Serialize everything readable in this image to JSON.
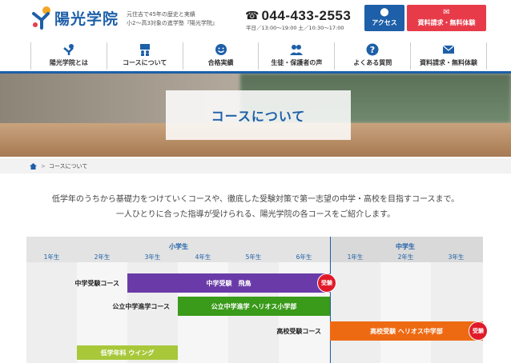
{
  "header": {
    "logo_text": "陽光学院",
    "tagline_line1": "元住吉で45年の歴史と実績",
    "tagline_line2": "小2〜高3対象の進学塾『陽光学院』",
    "phone_icon": "telephone-icon",
    "phone": "044-433-2553",
    "hours": "平日／13:00〜19:00  土／10:30〜17:00",
    "access_label": "アクセス",
    "request_label": "資料請求・無料体験"
  },
  "nav": {
    "items": [
      {
        "label": "陽光学院とは",
        "icon": "school-logo-icon"
      },
      {
        "label": "コースについて",
        "icon": "classroom-icon"
      },
      {
        "label": "合格実績",
        "icon": "smile-icon"
      },
      {
        "label": "生徒・保護者の声",
        "icon": "people-icon"
      },
      {
        "label": "よくある質問",
        "icon": "question-icon"
      },
      {
        "label": "資料請求・無料体験",
        "icon": "mail-icon"
      }
    ]
  },
  "hero": {
    "title": "コースについて"
  },
  "breadcrumb": {
    "home_icon": "home-icon",
    "separator": ">",
    "current": "コースについて"
  },
  "intro": {
    "line1": "低学年のうちから基礎力をつけていくコースや、徹底した受験対策で第一志望の中学・高校を目指すコースまで。",
    "line2": "一人ひとりに合った指導が受けられる、陽光学院の各コースをご紹介します。"
  },
  "course_table": {
    "elementary_label": "小学生",
    "junior_label": "中学生",
    "grades": [
      "1年生",
      "2年生",
      "3年生",
      "4年生",
      "5年生",
      "6年生",
      "1年生",
      "2年生",
      "3年生"
    ],
    "rows": [
      {
        "label": "中学受験コース",
        "bar": "中学受験　飛鳥",
        "color": "#6a3ba8",
        "badge": "受験"
      },
      {
        "label": "公立中学進学コース",
        "bar": "公立中学進学 ヘリオス小学部",
        "color": "#3a9a1a"
      },
      {
        "label": "高校受験コース",
        "bar": "高校受験 ヘリオス中学部",
        "color": "#ee6a12",
        "badge": "受験"
      },
      {
        "label": "",
        "bar": "低学年科 ウイング",
        "color": "#a8c83a"
      }
    ]
  },
  "colors": {
    "brand_blue": "#1d5fa8",
    "accent_red": "#e83b4a"
  }
}
